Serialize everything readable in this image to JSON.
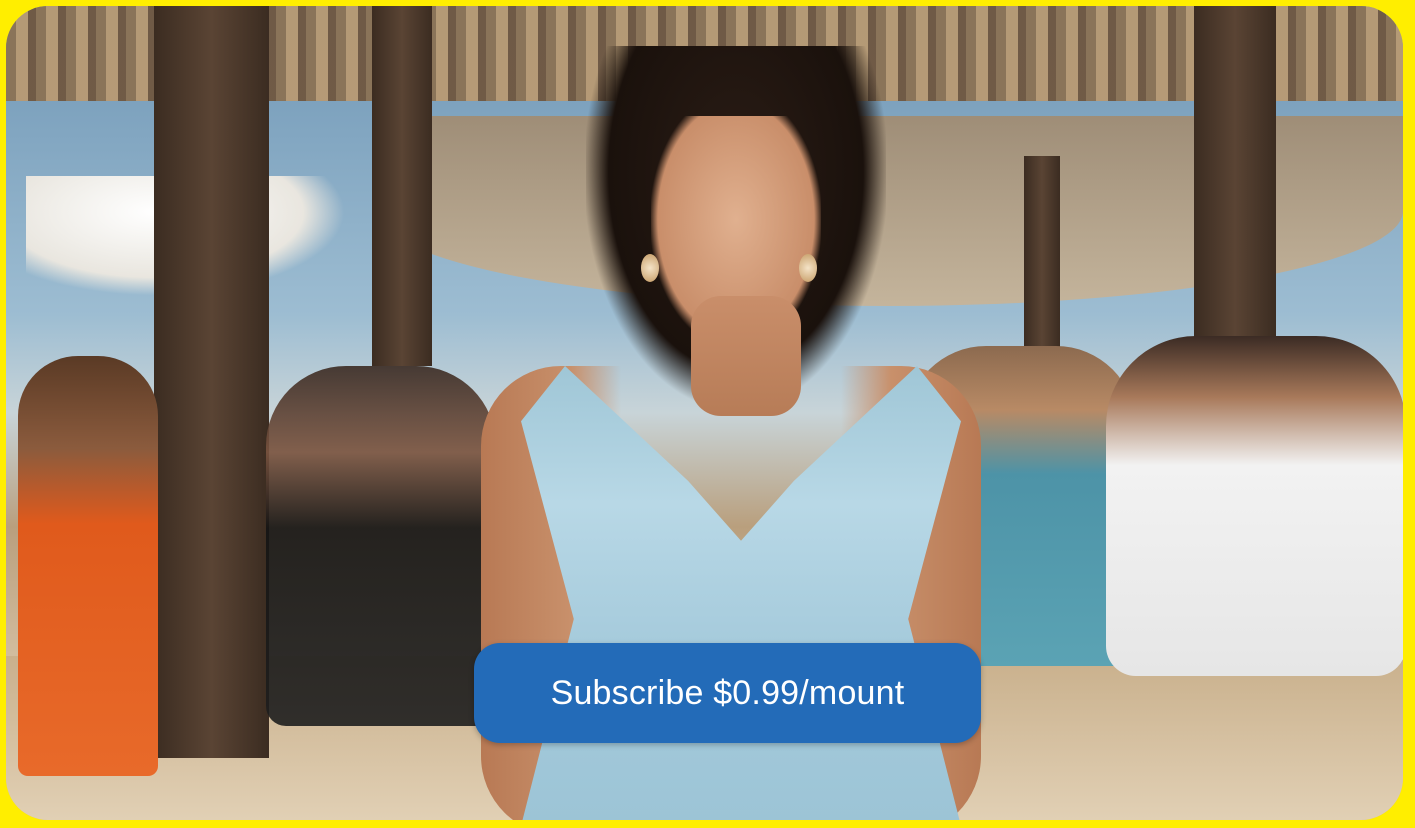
{
  "theme": {
    "frame_color": "#ffee00",
    "cta_color": "#236bb8",
    "cta_text_color": "#ffffff"
  },
  "hero": {
    "image_name": "beach-portrait-photo"
  },
  "cta": {
    "label": "Subscribe $0.99/mount"
  }
}
